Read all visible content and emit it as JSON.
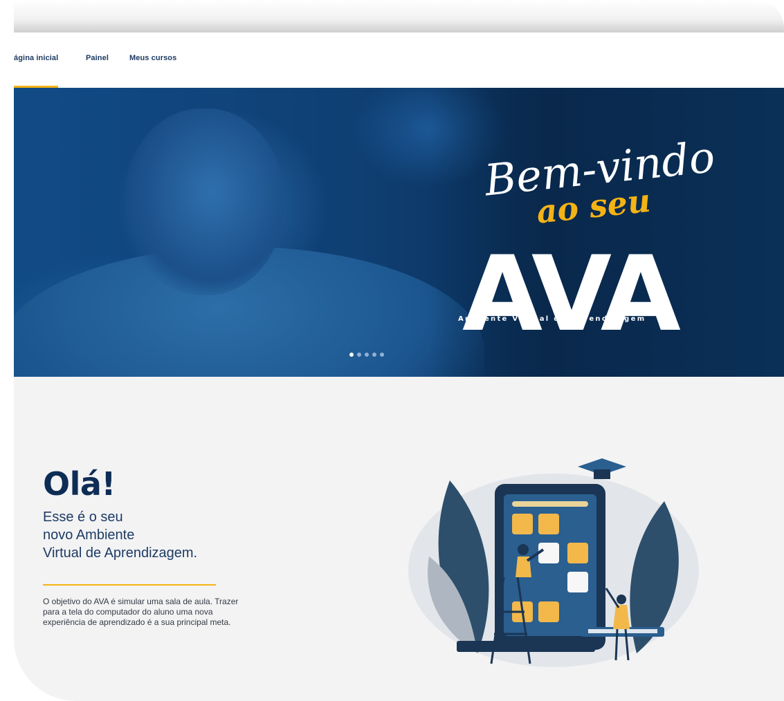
{
  "nav": {
    "items": [
      {
        "label": "ágina inicial",
        "active": true
      },
      {
        "label": "Painel",
        "active": false
      },
      {
        "label": "Meus cursos",
        "active": false
      }
    ]
  },
  "hero": {
    "headline_script": "Bem-vindo",
    "headline_accent": "ao seu",
    "headline_big": "AVA",
    "tagline": "Ambiente Virtual de Aprendizagem",
    "slide_count": 5,
    "active_slide": 1
  },
  "welcome": {
    "greeting": "Olá!",
    "subtitle_lines": [
      "Esse é o seu",
      "novo Ambiente",
      "Virtual de Aprendizagem."
    ],
    "description": "O objetivo do AVA é simular uma sala de aula. Trazer para a tela do computador do aluno uma nova experiência de aprendizado é a sua principal meta."
  },
  "colors": {
    "brand_navy": "#0e2d55",
    "hero_blue": "#0f3f73",
    "accent_yellow": "#f4b315"
  }
}
